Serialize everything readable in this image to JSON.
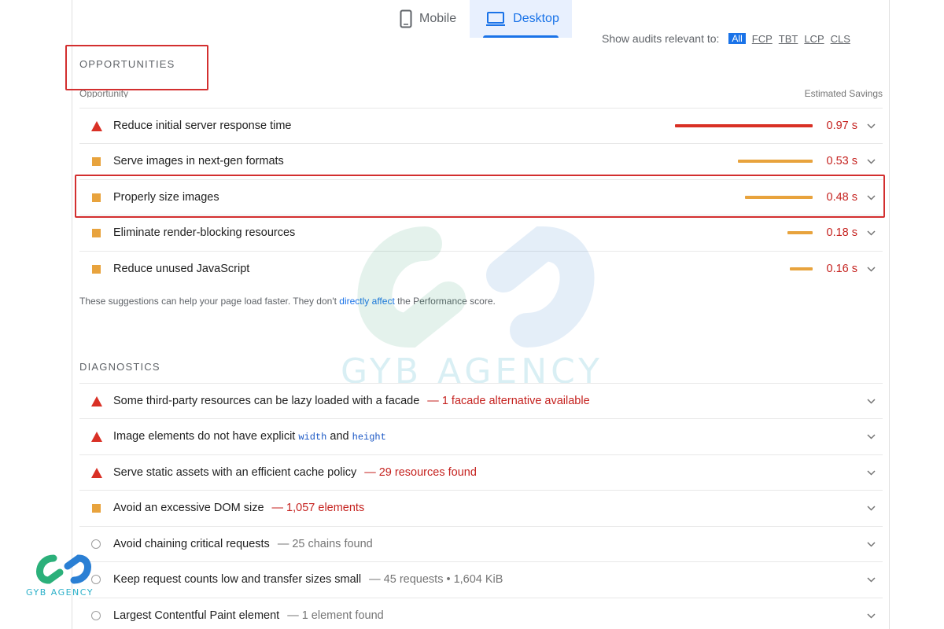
{
  "device_tabs": [
    {
      "label": "Mobile",
      "icon": "phone-icon",
      "active": false
    },
    {
      "label": "Desktop",
      "icon": "laptop-icon",
      "active": true
    }
  ],
  "filter": {
    "label": "Show audits relevant to:",
    "chips": [
      "All",
      "FCP",
      "TBT",
      "LCP",
      "CLS"
    ],
    "selected": "All"
  },
  "opportunities": {
    "title": "OPPORTUNITIES",
    "col_left": "Opportunity",
    "col_right": "Estimated Savings",
    "items": [
      {
        "icon": "fail-triangle-icon",
        "title": "Reduce initial server response time",
        "savings": "0.97 s",
        "bar_fraction": 0.97,
        "bar_color": "#d93025"
      },
      {
        "icon": "average-square-icon",
        "title": "Serve images in next-gen formats",
        "savings": "0.53 s",
        "bar_fraction": 0.53,
        "bar_color": "#e8a33d"
      },
      {
        "icon": "average-square-icon",
        "title": "Properly size images",
        "savings": "0.48 s",
        "bar_fraction": 0.48,
        "bar_color": "#e8a33d"
      },
      {
        "icon": "average-square-icon",
        "title": "Eliminate render-blocking resources",
        "savings": "0.18 s",
        "bar_fraction": 0.18,
        "bar_color": "#e8a33d"
      },
      {
        "icon": "average-square-icon",
        "title": "Reduce unused JavaScript",
        "savings": "0.16 s",
        "bar_fraction": 0.16,
        "bar_color": "#e8a33d"
      }
    ],
    "note": {
      "before": "These suggestions can help your page load faster. They don't ",
      "link": "directly affect",
      "after": " the Performance score."
    }
  },
  "diagnostics": {
    "title": "DIAGNOSTICS",
    "items": [
      {
        "icon": "fail-triangle-icon",
        "title": "Some third-party resources can be lazy loaded with a facade",
        "detail": "— 1 facade alternative available",
        "tone": "red"
      },
      {
        "icon": "fail-triangle-icon",
        "title_before": "Image elements do not have explicit ",
        "code1": "width",
        "title_mid": " and ",
        "code2": "height"
      },
      {
        "icon": "fail-triangle-icon",
        "title": "Serve static assets with an efficient cache policy",
        "detail": "— 29 resources found",
        "tone": "red"
      },
      {
        "icon": "average-square-icon",
        "title": "Avoid an excessive DOM size",
        "detail": "— 1,057 elements",
        "tone": "red"
      },
      {
        "icon": "info-circle-icon",
        "title": "Avoid chaining critical requests",
        "detail": "— 25 chains found",
        "tone": "grey"
      },
      {
        "icon": "info-circle-icon",
        "title": "Keep request counts low and transfer sizes small",
        "detail": "— 45 requests • 1,604 KiB",
        "tone": "grey"
      },
      {
        "icon": "info-circle-icon",
        "title": "Largest Contentful Paint element",
        "detail": "— 1 element found",
        "tone": "grey"
      }
    ]
  },
  "watermark": {
    "text": "GYB AGENCY"
  },
  "logo": {
    "text": "GYB AGENCY"
  }
}
